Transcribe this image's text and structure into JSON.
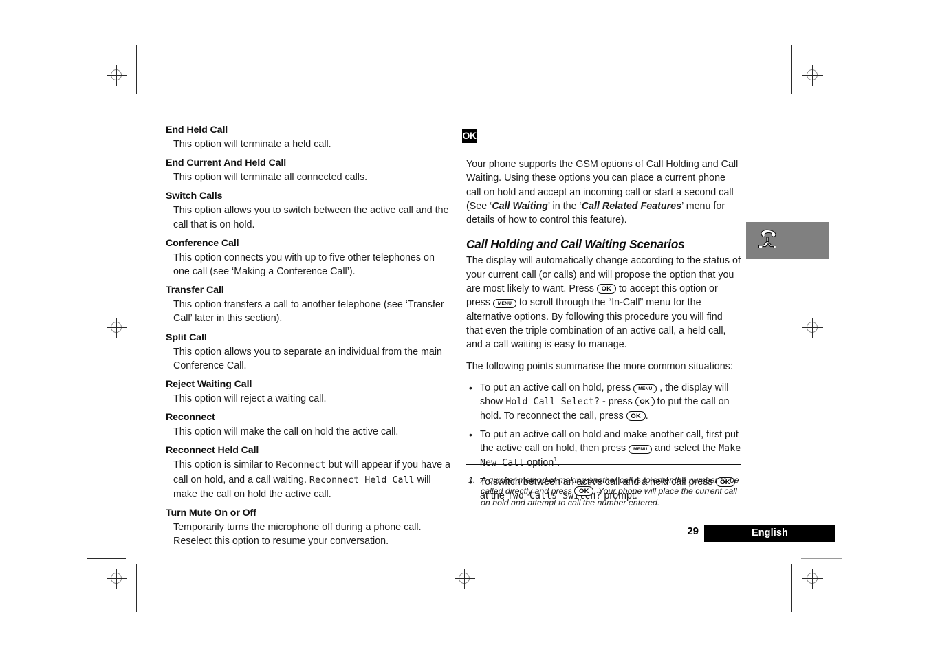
{
  "document": {
    "page_number": "29",
    "language_label": "English",
    "side_tab_icon": "phone-handset-in-call-icon",
    "ok_badge_label": "OK"
  },
  "left_column": {
    "options": [
      {
        "heading": "End Held Call",
        "body": "This option will terminate a held call."
      },
      {
        "heading": "End Current And Held Call",
        "body": "This option will terminate all connected calls."
      },
      {
        "heading": "Switch Calls",
        "body": "This option allows you to switch between the active call and the call that is on hold."
      },
      {
        "heading": "Conference Call",
        "body": "This option connects you with up to five other telephones on one call (see ‘Making a Conference Call’)."
      },
      {
        "heading": "Transfer Call",
        "body": "This option transfers a call to another telephone (see ‘Transfer Call’ later in this section)."
      },
      {
        "heading": "Split Call",
        "body": "This option allows you to separate an individual from the main Conference Call."
      },
      {
        "heading": "Reject Waiting Call",
        "body": "This option will reject a waiting call."
      },
      {
        "heading": "Reconnect",
        "body": "This option will make the call on hold the active call."
      },
      {
        "heading": "Reconnect Held Call",
        "body_part1": "This option is similar to ",
        "body_lcd1": "Reconnect",
        "body_part2": " but will appear if you have a call on hold, and a call waiting. ",
        "body_lcd2": "Reconnect Held Call",
        "body_part3": " will make the call on hold the active call."
      },
      {
        "heading": "Turn Mute On or Off",
        "body": "Temporarily turns the microphone off during a phone call. Reselect this option to resume your conversation."
      }
    ]
  },
  "right_column": {
    "intro_part1": "Your phone supports the GSM options of Call Holding and Call Waiting. Using these options you can place a current phone call on hold and accept an incoming call or start a second call (See ‘",
    "intro_bold1": "Call Waiting",
    "intro_part2": "’ in the ‘",
    "intro_bold2": "Call Related Features",
    "intro_part3": "’ menu for details of how to control this feature).",
    "section_heading": "Call Holding and Call Waiting Scenarios",
    "scenario_part1": "The display will automatically change according to the status of your current call (or calls) and will propose the option that you are most likely to want. Press ",
    "scenario_key1": "OK",
    "scenario_part2": " to accept this option or press ",
    "scenario_key2": "MENU",
    "scenario_part3": " to scroll through the “In-Call” menu for the alternative options. By following this procedure you will find that even the triple combination of an active call, a held call, and a call waiting is easy to manage.",
    "summary_line": "The following points summarise the more common situations:",
    "bullet_char": "•",
    "bullets": [
      {
        "p1": "To put an active call on hold, press ",
        "k1": "MENU",
        "p2": " , the display will show ",
        "lcd1": "Hold Call Select?",
        "p3": " - press ",
        "k2": "OK",
        "p4": " to put the call on hold. To reconnect the call, press ",
        "k3": "OK",
        "p5": "."
      },
      {
        "p1": "To put an active call on hold and make another call, first put the active call on hold, then press ",
        "k1": "MENU",
        "p2": " and select the ",
        "lcd1": "Make New Call",
        "p3": " option",
        "sup": "1",
        "p4": "."
      },
      {
        "p1": "To switch between an active call and a held call press ",
        "k1": "OK",
        "p2": " at the ",
        "lcd1": "Two Calls Switch?",
        "p3": " prompt."
      }
    ]
  },
  "footnote": {
    "number": "1.",
    "part1": "A quicker method of making another call is to enter the number to be called directly and press ",
    "key": "OK",
    "part2": ". Your phone will place the current call on hold and attempt to call the number entered."
  }
}
